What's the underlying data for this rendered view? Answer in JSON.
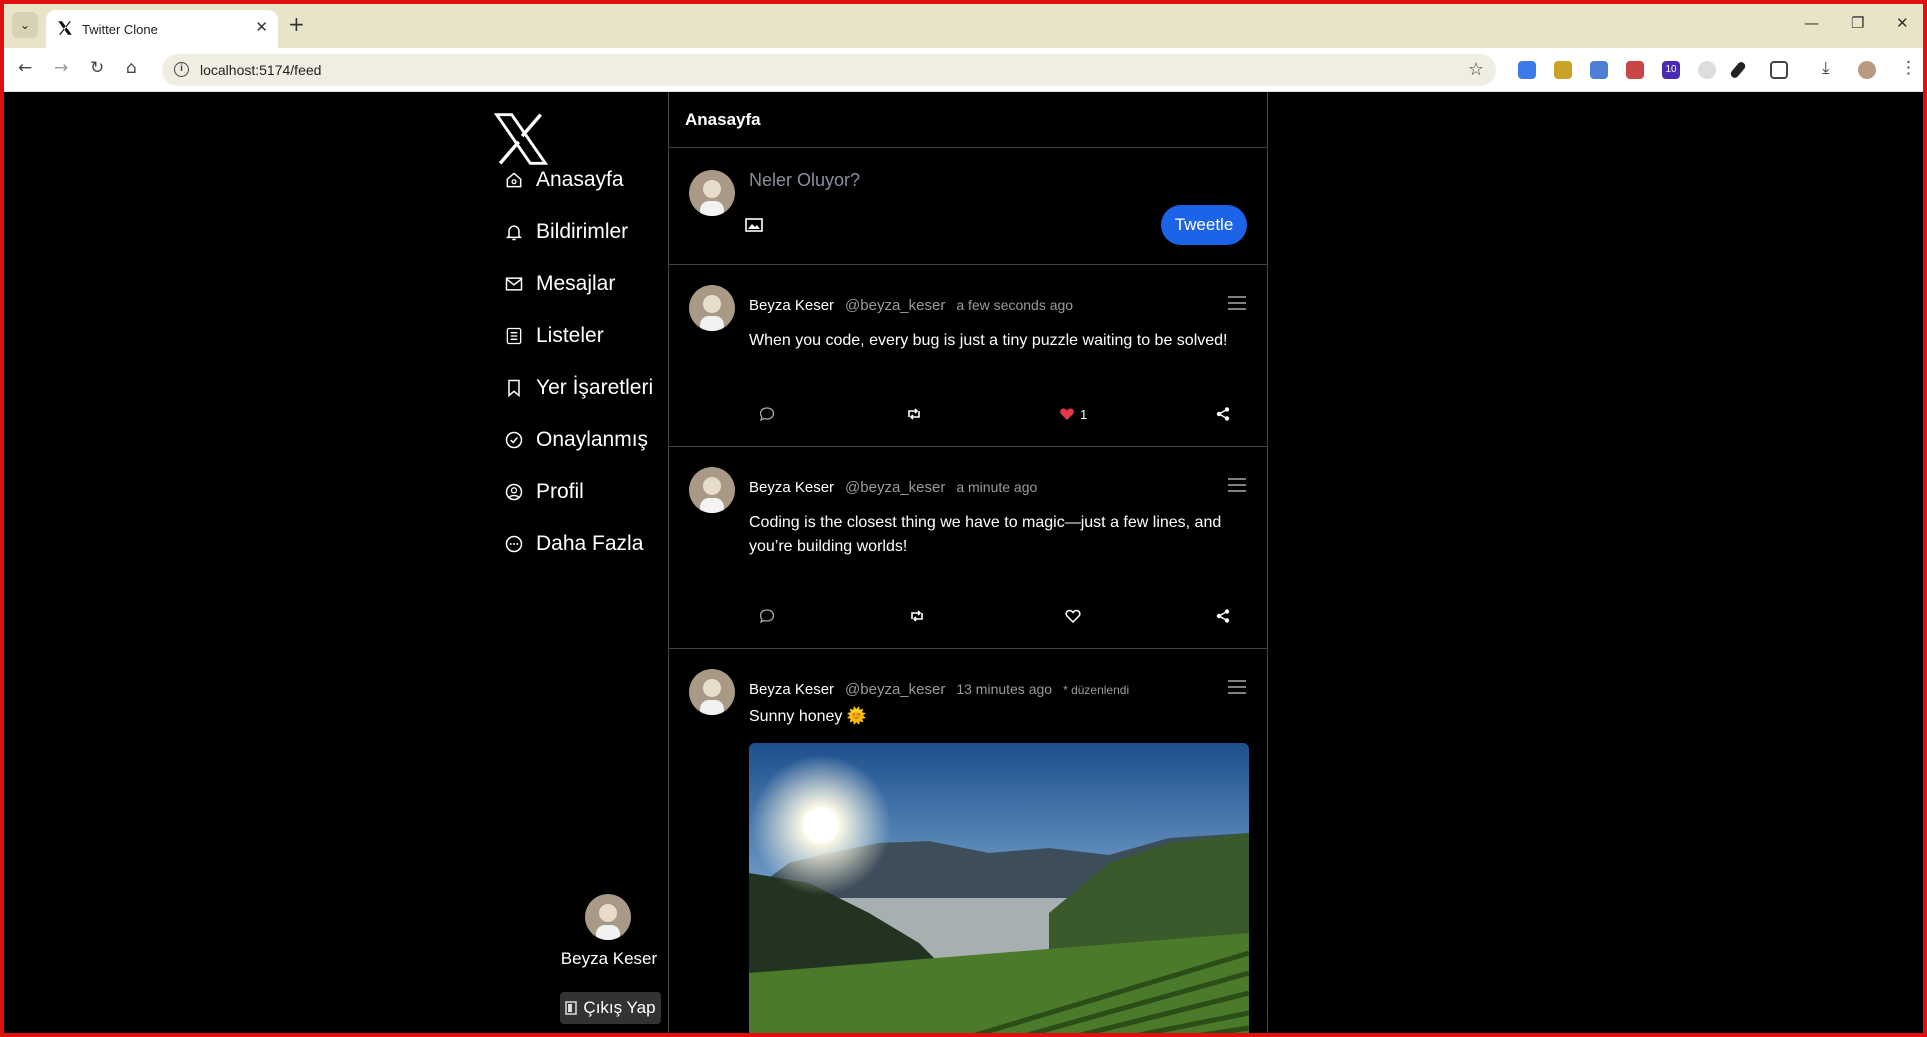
{
  "browser": {
    "tab_title": "Twitter Clone",
    "url": "localhost:5174/feed",
    "extension_badge": "10"
  },
  "sidebar": {
    "items": [
      {
        "label": "Anasayfa",
        "icon": "home-icon"
      },
      {
        "label": "Bildirimler",
        "icon": "bell-icon"
      },
      {
        "label": "Mesajlar",
        "icon": "mail-icon"
      },
      {
        "label": "Listeler",
        "icon": "list-icon"
      },
      {
        "label": "Yer İşaretleri",
        "icon": "bookmark-icon"
      },
      {
        "label": "Onaylanmış",
        "icon": "check-circle-icon"
      },
      {
        "label": "Profil",
        "icon": "user-circle-icon"
      },
      {
        "label": "Daha Fazla",
        "icon": "more-circle-icon"
      }
    ],
    "user_name": "Beyza Keser",
    "logout_label": "Çıkış Yap"
  },
  "feed": {
    "title": "Anasayfa",
    "composer": {
      "placeholder": "Neler Oluyor?",
      "submit_label": "Tweetle"
    },
    "posts": [
      {
        "name": "Beyza Keser",
        "handle": "@beyza_keser",
        "time": "a few seconds ago",
        "text": "When you code, every bug is just a tiny puzzle waiting to be solved!",
        "likes": "1",
        "liked": true
      },
      {
        "name": "Beyza Keser",
        "handle": "@beyza_keser",
        "time": "a minute ago",
        "text": "Coding is the closest thing we have to magic—just a few lines, and you’re building worlds!",
        "likes": "",
        "liked": false
      },
      {
        "name": "Beyza Keser",
        "handle": "@beyza_keser",
        "time": "13 minutes ago",
        "edited": "* düzenlendi",
        "text": "Sunny honey 🌞",
        "image": "sunrise-landscape"
      }
    ]
  },
  "colors": {
    "accent": "#1d63e8",
    "like": "#e53945",
    "border": "#444444",
    "frame": "#e01010"
  }
}
